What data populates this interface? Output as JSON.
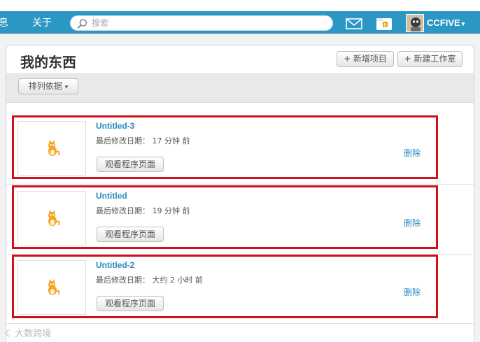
{
  "nav": {
    "partial_item": "息",
    "about": "关于",
    "search_placeholder": "搜索",
    "user_name": "CCFIVE",
    "caret": "▾"
  },
  "panel": {
    "title": "我的东西",
    "new_project": "+ 新增项目",
    "new_studio": "+ 新建工作室",
    "sort_by": "排列依据",
    "caret": "▾"
  },
  "projects": [
    {
      "title": "Untitled-3",
      "meta": "最后修改日期： 17 分钟 前",
      "view": "观看程序页面",
      "delete": "删除"
    },
    {
      "title": "Untitled",
      "meta": "最后修改日期： 19 分钟 前",
      "view": "观看程序页面",
      "delete": "删除"
    },
    {
      "title": "Untitled-2",
      "meta": "最后修改日期： 大约 2 小时 前",
      "view": "观看程序页面",
      "delete": "删除"
    }
  ],
  "watermark": "大数跨境",
  "colors": {
    "nav_bg": "#2a97c5",
    "link": "#2a8bbd",
    "highlight": "#d0101b"
  },
  "icons": {
    "search": "search-icon",
    "mail": "mail-icon",
    "folder": "folder-icon",
    "project_thumb": "scratch-cat-icon"
  }
}
